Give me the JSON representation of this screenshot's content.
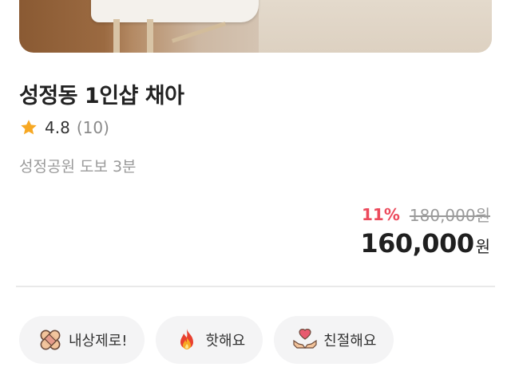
{
  "shop": {
    "name": "성정동 1인샵 채아",
    "rating": "4.8",
    "review_count": "(10)",
    "location": "성정공원 도보 3분"
  },
  "price": {
    "discount": "11%",
    "original": "180,000원",
    "final_amount": "160,000",
    "final_unit": "원"
  },
  "tags": [
    {
      "label": "내상제로!",
      "icon": "bandage-icon"
    },
    {
      "label": "핫해요",
      "icon": "fire-icon"
    },
    {
      "label": "친절해요",
      "icon": "heart-hands-icon"
    }
  ],
  "colors": {
    "discount": "#ec4a5c",
    "star": "#f7a823",
    "tag_bg": "#f4f4f5"
  }
}
